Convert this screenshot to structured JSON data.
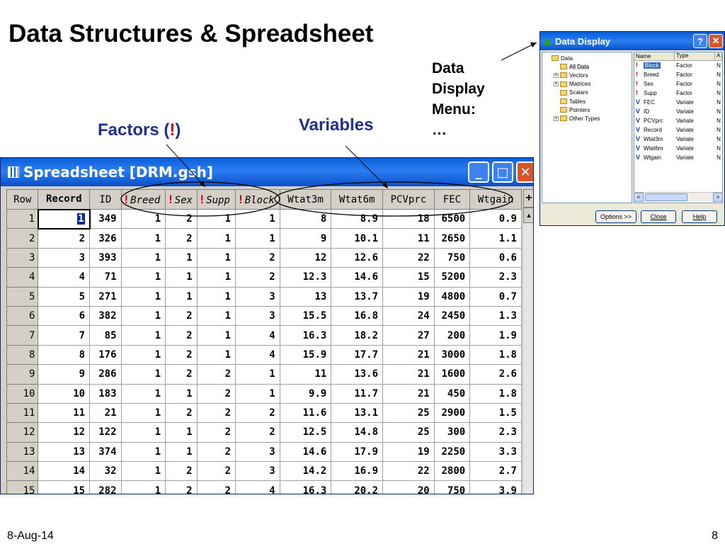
{
  "slide": {
    "title": "Data Structures & Spreadsheet",
    "factors_label": "Factors (",
    "factors_bang": "!",
    "factors_close": ")",
    "variables_label": "Variables",
    "menu_label_lines": [
      "Data",
      "Display",
      "Menu:",
      "…"
    ],
    "date": "8-Aug-14",
    "page_number": "8"
  },
  "spreadsheet": {
    "window_title": "Spreadsheet [DRM.gsh]",
    "buttons": {
      "minimize": "_",
      "maximize": "□",
      "close": "✕"
    },
    "scroll_plus": "+",
    "scroll_up": "▲",
    "columns": [
      {
        "label": "Row",
        "kind": "rowhdr"
      },
      {
        "label": "Record",
        "kind": "bold"
      },
      {
        "label": "ID",
        "kind": "plain"
      },
      {
        "label": "Breed",
        "kind": "factor"
      },
      {
        "label": "Sex",
        "kind": "factor"
      },
      {
        "label": "Supp",
        "kind": "factor"
      },
      {
        "label": "Block",
        "kind": "factor"
      },
      {
        "label": "Wtat3m",
        "kind": "plain"
      },
      {
        "label": "Wtat6m",
        "kind": "plain"
      },
      {
        "label": "PCVprc",
        "kind": "plain"
      },
      {
        "label": "FEC",
        "kind": "plain"
      },
      {
        "label": "Wtgain",
        "kind": "plain"
      }
    ],
    "rows": [
      [
        "1",
        "1",
        "349",
        "1",
        "2",
        "1",
        "1",
        "8",
        "8.9",
        "18",
        "6500",
        "0.9"
      ],
      [
        "2",
        "2",
        "326",
        "1",
        "2",
        "1",
        "1",
        "9",
        "10.1",
        "11",
        "2650",
        "1.1"
      ],
      [
        "3",
        "3",
        "393",
        "1",
        "1",
        "1",
        "2",
        "12",
        "12.6",
        "22",
        "750",
        "0.6"
      ],
      [
        "4",
        "4",
        "71",
        "1",
        "1",
        "1",
        "2",
        "12.3",
        "14.6",
        "15",
        "5200",
        "2.3"
      ],
      [
        "5",
        "5",
        "271",
        "1",
        "1",
        "1",
        "3",
        "13",
        "13.7",
        "19",
        "4800",
        "0.7"
      ],
      [
        "6",
        "6",
        "382",
        "1",
        "2",
        "1",
        "3",
        "15.5",
        "16.8",
        "24",
        "2450",
        "1.3"
      ],
      [
        "7",
        "7",
        "85",
        "1",
        "2",
        "1",
        "4",
        "16.3",
        "18.2",
        "27",
        "200",
        "1.9"
      ],
      [
        "8",
        "8",
        "176",
        "1",
        "2",
        "1",
        "4",
        "15.9",
        "17.7",
        "21",
        "3000",
        "1.8"
      ],
      [
        "9",
        "9",
        "286",
        "1",
        "2",
        "2",
        "1",
        "11",
        "13.6",
        "21",
        "1600",
        "2.6"
      ],
      [
        "10",
        "10",
        "183",
        "1",
        "1",
        "2",
        "1",
        "9.9",
        "11.7",
        "21",
        "450",
        "1.8"
      ],
      [
        "11",
        "11",
        "21",
        "1",
        "2",
        "2",
        "2",
        "11.6",
        "13.1",
        "25",
        "2900",
        "1.5"
      ],
      [
        "12",
        "12",
        "122",
        "1",
        "1",
        "2",
        "2",
        "12.5",
        "14.8",
        "25",
        "300",
        "2.3"
      ],
      [
        "13",
        "13",
        "374",
        "1",
        "1",
        "2",
        "3",
        "14.6",
        "17.9",
        "19",
        "2250",
        "3.3"
      ],
      [
        "14",
        "14",
        "32",
        "1",
        "2",
        "2",
        "3",
        "14.2",
        "16.9",
        "22",
        "2800",
        "2.7"
      ],
      [
        "15",
        "15",
        "282",
        "1",
        "2",
        "2",
        "4",
        "16.3",
        "20.2",
        "20",
        "750",
        "3.9"
      ]
    ]
  },
  "data_display": {
    "window_title": "Data Display",
    "buttons": {
      "help": "?",
      "close": "✕"
    },
    "tree": [
      {
        "label": "Data",
        "level": 0,
        "expander": ""
      },
      {
        "label": "All Data",
        "level": 1,
        "expander": "",
        "selected": true
      },
      {
        "label": "Vectors",
        "level": 1,
        "expander": "+"
      },
      {
        "label": "Matrices",
        "level": 1,
        "expander": "+"
      },
      {
        "label": "Scalars",
        "level": 1,
        "expander": ""
      },
      {
        "label": "Tables",
        "level": 1,
        "expander": ""
      },
      {
        "label": "Pointers",
        "level": 1,
        "expander": ""
      },
      {
        "label": "Other Types",
        "level": 1,
        "expander": "+"
      }
    ],
    "list_headers": [
      "Name",
      "Type",
      "A"
    ],
    "list_items": [
      {
        "name": "Block",
        "type": "Factor",
        "a": "N",
        "icon": "factor-icon",
        "selected": true
      },
      {
        "name": "Breed",
        "type": "Factor",
        "a": "N",
        "icon": "factor-icon"
      },
      {
        "name": "Sex",
        "type": "Factor",
        "a": "N",
        "icon": "factor-icon"
      },
      {
        "name": "Supp",
        "type": "Factor",
        "a": "N",
        "icon": "factor-icon"
      },
      {
        "name": "FEC",
        "type": "Variate",
        "a": "N",
        "icon": "variate-icon"
      },
      {
        "name": "ID",
        "type": "Variate",
        "a": "N",
        "icon": "variate-icon"
      },
      {
        "name": "PCVprc",
        "type": "Variate",
        "a": "N",
        "icon": "variate-icon"
      },
      {
        "name": "Record",
        "type": "Variate",
        "a": "N",
        "icon": "variate-icon"
      },
      {
        "name": "Wtat3m",
        "type": "Variate",
        "a": "N",
        "icon": "variate-icon"
      },
      {
        "name": "Wtat6m",
        "type": "Variate",
        "a": "N",
        "icon": "variate-icon"
      },
      {
        "name": "Wtgain",
        "type": "Variate",
        "a": "N",
        "icon": "variate-icon"
      }
    ],
    "scroll_left": "<",
    "scroll_right": ">",
    "options_button": "Options >>",
    "close_button": "Close",
    "help_button": "Help"
  }
}
